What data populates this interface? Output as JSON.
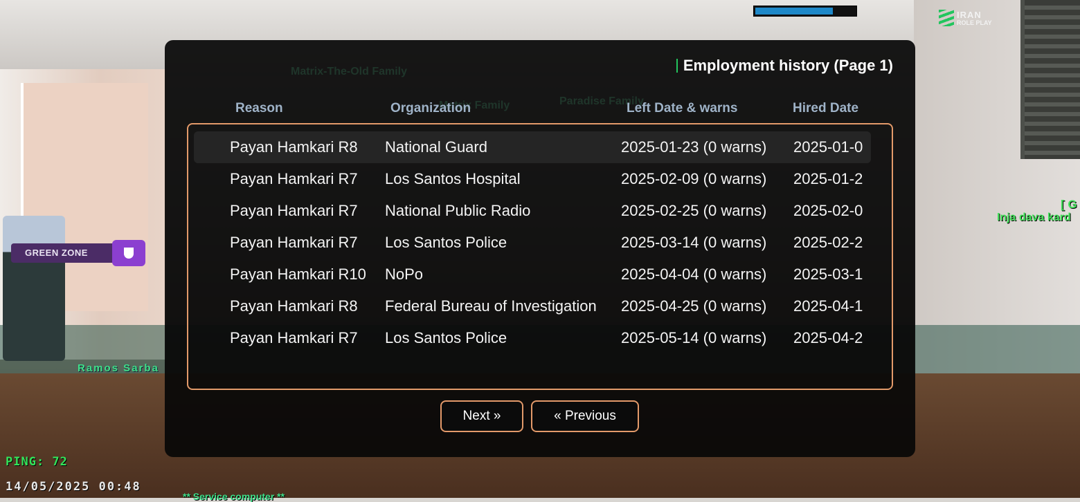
{
  "hud": {
    "health_fraction": 0.78,
    "server_logo_line1": "IRAN",
    "server_logo_line2": "ROLE PLAY",
    "zone_label": "GREEN ZONE",
    "ping_text": "PING: 72",
    "datetime_text": "14/05/2025 00:48"
  },
  "world_labels": {
    "player_name": "Ramos Sarba",
    "service_text": "** Service computer **",
    "right_tag": "[ G",
    "right_chat": "Inja dava kard",
    "ghost_1": "Matrix-The-Old Family",
    "ghost_2": "Matrix Family",
    "ghost_3": "Paradise Family"
  },
  "dialog": {
    "title": "Employment history (Page 1)",
    "columns": [
      "Reason",
      "Organization",
      "Left Date & warns",
      "Hired Date"
    ],
    "rows": [
      {
        "reason": "Payan Hamkari R8",
        "organization": "National Guard",
        "left": "2025-01-23 (0 warns)",
        "hired": "2025-01-0"
      },
      {
        "reason": "Payan Hamkari R7",
        "organization": "Los Santos Hospital",
        "left": "2025-02-09 (0 warns)",
        "hired": "2025-01-2"
      },
      {
        "reason": "Payan Hamkari R7",
        "organization": "National Public Radio",
        "left": "2025-02-25 (0 warns)",
        "hired": "2025-02-0"
      },
      {
        "reason": "Payan Hamkari R7",
        "organization": "Los Santos Police",
        "left": "2025-03-14 (0 warns)",
        "hired": "2025-02-2"
      },
      {
        "reason": "Payan Hamkari R10",
        "organization": "NoPo",
        "left": "2025-04-04 (0 warns)",
        "hired": "2025-03-1"
      },
      {
        "reason": "Payan Hamkari R8",
        "organization": "Federal Bureau of Investigation",
        "left": "2025-04-25 (0 warns)",
        "hired": "2025-04-1"
      },
      {
        "reason": "Payan Hamkari R7",
        "organization": "Los Santos Police",
        "left": "2025-05-14 (0 warns)",
        "hired": "2025-04-2"
      }
    ],
    "selected_row": 0,
    "next_label": "Next »",
    "prev_label": "« Previous"
  },
  "colors": {
    "accent_border": "#e39a6a",
    "header_text": "#9fb3c8",
    "title_accent": "#22c55e",
    "health": "#1e88c8",
    "zone_badge": "#8b3fd0"
  }
}
